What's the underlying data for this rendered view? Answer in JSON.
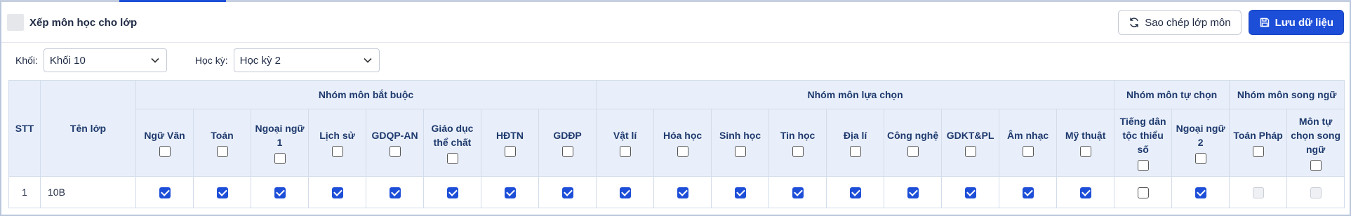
{
  "header": {
    "title": "Xếp môn học cho lớp"
  },
  "actions": {
    "copy_label": "Sao chép lớp môn",
    "save_label": "Lưu dữ liệu"
  },
  "filters": {
    "grade_label": "Khối:",
    "grade_value": "Khối 10",
    "term_label": "Học kỳ:",
    "term_value": "Học kỳ 2"
  },
  "table": {
    "stt_header": "STT",
    "class_header": "Tên lớp",
    "groups": {
      "required": "Nhóm môn bắt buộc",
      "elective": "Nhóm môn lựa chọn",
      "self": "Nhóm môn tự chọn",
      "bilingual": "Nhóm môn song ngữ"
    },
    "subjects": [
      "Ngữ Văn",
      "Toán",
      "Ngoại ngữ 1",
      "Lịch sử",
      "GDQP-AN",
      "Giáo dục thể chất",
      "HĐTN",
      "GDĐP",
      "Vật lí",
      "Hóa học",
      "Sinh học",
      "Tin học",
      "Địa lí",
      "Công nghệ",
      "GDKT&PL",
      "Âm nhạc",
      "Mỹ thuật",
      "Tiếng dân tộc thiểu số",
      "Ngoại ngữ 2",
      "Toán Pháp",
      "Môn tự chọn song ngữ"
    ],
    "rows": [
      {
        "stt": "1",
        "name": "10B"
      }
    ]
  }
}
